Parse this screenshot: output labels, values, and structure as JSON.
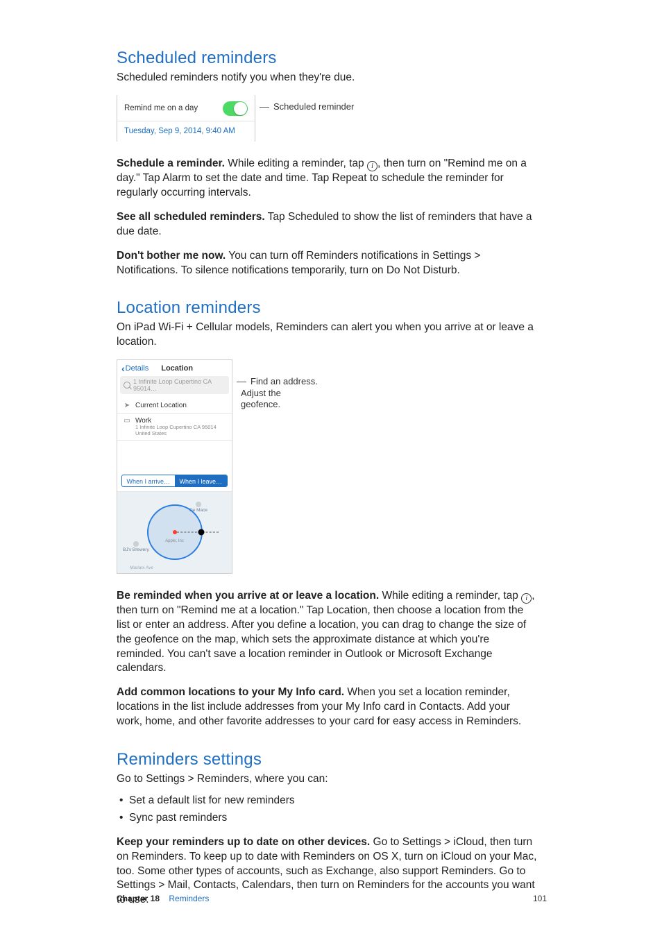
{
  "sections": {
    "scheduled": {
      "title": "Scheduled reminders",
      "intro": "Scheduled reminders notify you when they're due.",
      "fig": {
        "label": "Remind me on a day",
        "date": "Tuesday, Sep 9, 2014, 9:40 AM",
        "callout": "Scheduled reminder"
      },
      "p1_bold": "Schedule a reminder.",
      "p1_rest": " While editing a reminder, tap ",
      "p1_rest2": ", then turn on \"Remind me on a day.\" Tap Alarm to set the date and time. Tap Repeat to schedule the reminder for regularly occurring intervals.",
      "p2_bold": "See all scheduled reminders.",
      "p2_rest": " Tap Scheduled to show the list of reminders that have a due date.",
      "p3_bold": "Don't bother me now.",
      "p3_rest": " You can turn off Reminders notifications in Settings > Notifications. To silence notifications temporarily, turn on Do Not Disturb."
    },
    "location": {
      "title": "Location reminders",
      "intro": "On iPad Wi-Fi + Cellular models, Reminders can alert you when you arrive at or leave a location.",
      "fig": {
        "back": "Details",
        "title": "Location",
        "search": "1 Infinite Loop Cupertino CA 95014…",
        "current": "Current Location",
        "work": "Work",
        "work_sub": "1 Infinite Loop Cupertino CA 95014 United States",
        "seg_arrive": "When I arrive…",
        "seg_leave": "When I leave…",
        "poi_mace": "De Mace",
        "poi_brew": "BJ's Brewery",
        "apple": "Apple, Inc",
        "road": "Mariani Ave",
        "callout1": "Find an address.",
        "callout2a": "Adjust the",
        "callout2b": "geofence."
      },
      "p1_bold": "Be reminded when you arrive at or leave a location.",
      "p1_rest": " While editing a reminder, tap ",
      "p1_rest2": ", then turn on \"Remind me at a location.\" Tap Location, then choose a location from the list or enter an address. After you define a location, you can drag to change the size of the geofence on the map, which sets the approximate distance at which you're reminded. You can't save a location reminder in Outlook or Microsoft Exchange calendars.",
      "p2_bold": "Add common locations to your My Info card.",
      "p2_rest": " When you set a location reminder, locations in the list include addresses from your My Info card in Contacts. Add your work, home, and other favorite addresses to your card for easy access in Reminders."
    },
    "settings": {
      "title": "Reminders settings",
      "intro": "Go to Settings > Reminders, where you can:",
      "bullet1": "Set a default list for new reminders",
      "bullet2": "Sync past reminders",
      "p1_bold": "Keep your reminders up to date on other devices.",
      "p1_rest": " Go to Settings > iCloud, then turn on Reminders. To keep up to date with Reminders on OS X, turn on iCloud on your Mac, too. Some other types of accounts, such as Exchange, also support Reminders. Go to Settings > Mail, Contacts, Calendars, then turn on Reminders for the accounts you want to use."
    }
  },
  "footer": {
    "chapter": "Chapter  18",
    "name": "Reminders",
    "page": "101"
  },
  "glyphs": {
    "info": "i"
  }
}
